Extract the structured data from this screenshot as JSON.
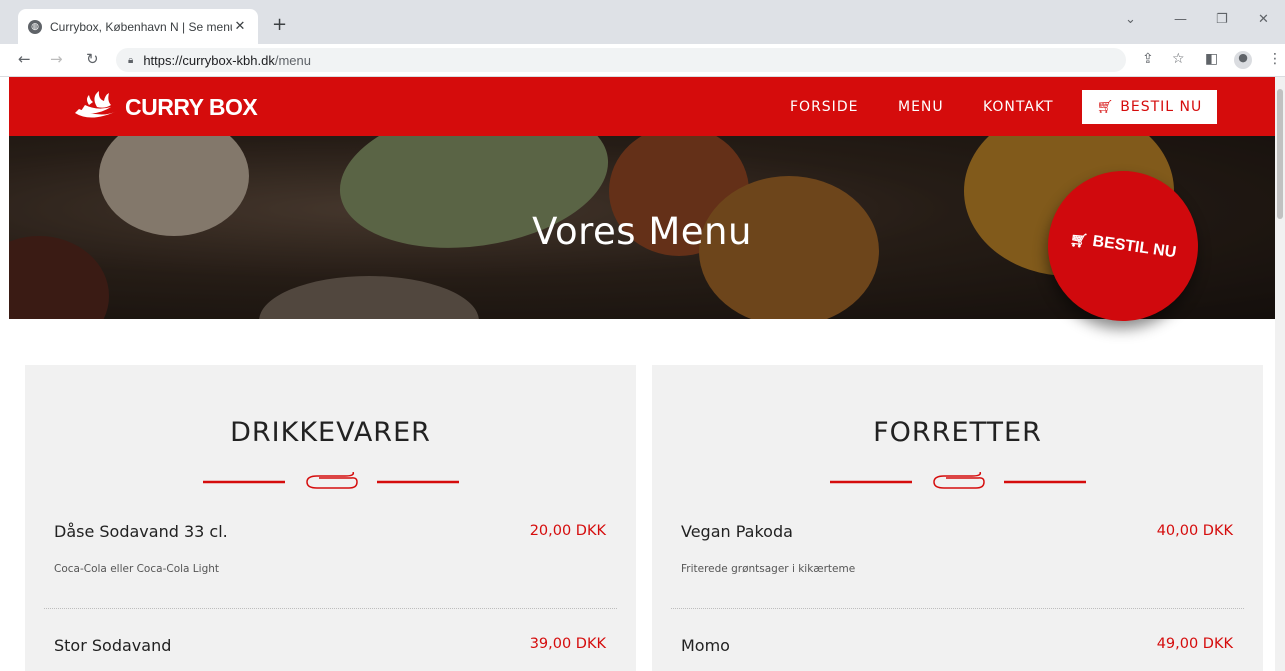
{
  "browser": {
    "tab_title": "Currybox, København N | Se menu",
    "tab_close": "✕",
    "new_tab": "+",
    "url_host": "https://currybox-kbh.dk",
    "url_path": "/menu"
  },
  "header": {
    "brand": "CURRY BOX",
    "nav": [
      "FORSIDE",
      "MENU",
      "KONTAKT"
    ],
    "order_button": "BESTIL NU"
  },
  "hero": {
    "title": "Vores Menu",
    "order_badge": "BESTIL NU"
  },
  "sections": [
    {
      "heading": "DRIKKEVARER",
      "items": [
        {
          "name": "Dåse Sodavand 33 cl.",
          "price": "20,00 DKK",
          "description": "Coca-Cola eller Coca-Cola Light"
        },
        {
          "name": "Stor Sodavand",
          "price": "39,00 DKK",
          "description": ""
        }
      ]
    },
    {
      "heading": "FORRETTER",
      "items": [
        {
          "name": "Vegan Pakoda",
          "price": "40,00 DKK",
          "description": "Friterede grøntsager i kikærteme"
        },
        {
          "name": "Momo",
          "price": "49,00 DKK",
          "description": ""
        }
      ]
    }
  ],
  "colors": {
    "brand_red": "#d50c0c",
    "card_bg": "#f1f1f1"
  },
  "icons": [
    "globe-icon",
    "back-arrow-icon",
    "forward-arrow-icon",
    "reload-icon",
    "lock-icon",
    "share-icon",
    "star-icon",
    "sidebar-icon",
    "profile-icon",
    "menu-dots-icon",
    "cart-icon",
    "flame-logo-icon"
  ]
}
